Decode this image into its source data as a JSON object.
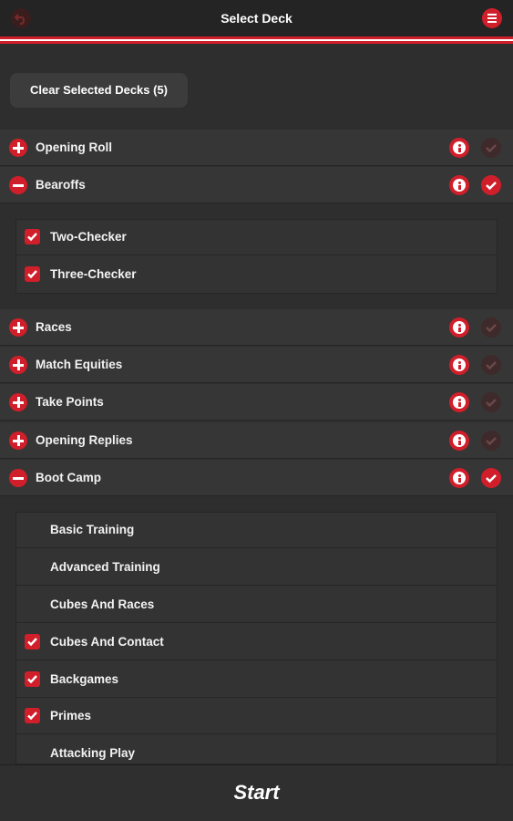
{
  "header": {
    "title": "Select Deck",
    "back_icon": "undo-arrow-icon",
    "menu_icon": "hamburger-menu-icon"
  },
  "clear_button": {
    "label": "Clear Selected Decks (5)"
  },
  "colors": {
    "accent": "#d01f2a",
    "background": "#2e2e2e",
    "row": "#363636"
  },
  "decks": {
    "opening_roll": {
      "label": "Opening Roll",
      "expanded": false,
      "selected": false
    },
    "bearoffs": {
      "label": "Bearoffs",
      "expanded": true,
      "selected": true,
      "items": [
        {
          "label": "Two-Checker",
          "checked": true
        },
        {
          "label": "Three-Checker",
          "checked": true
        }
      ]
    },
    "races": {
      "label": "Races",
      "expanded": false,
      "selected": false
    },
    "match_equities": {
      "label": "Match Equities",
      "expanded": false,
      "selected": false
    },
    "take_points": {
      "label": "Take Points",
      "expanded": false,
      "selected": false
    },
    "opening_replies": {
      "label": "Opening Replies",
      "expanded": false,
      "selected": false
    },
    "boot_camp": {
      "label": "Boot Camp",
      "expanded": true,
      "selected": true,
      "items": [
        {
          "label": "Basic Training",
          "checked": false
        },
        {
          "label": "Advanced Training",
          "checked": false
        },
        {
          "label": "Cubes And Races",
          "checked": false
        },
        {
          "label": "Cubes And Contact",
          "checked": true
        },
        {
          "label": "Backgames",
          "checked": true
        },
        {
          "label": "Primes",
          "checked": true
        },
        {
          "label": "Attacking Play",
          "checked": false
        }
      ]
    }
  },
  "footer": {
    "start_label": "Start"
  }
}
